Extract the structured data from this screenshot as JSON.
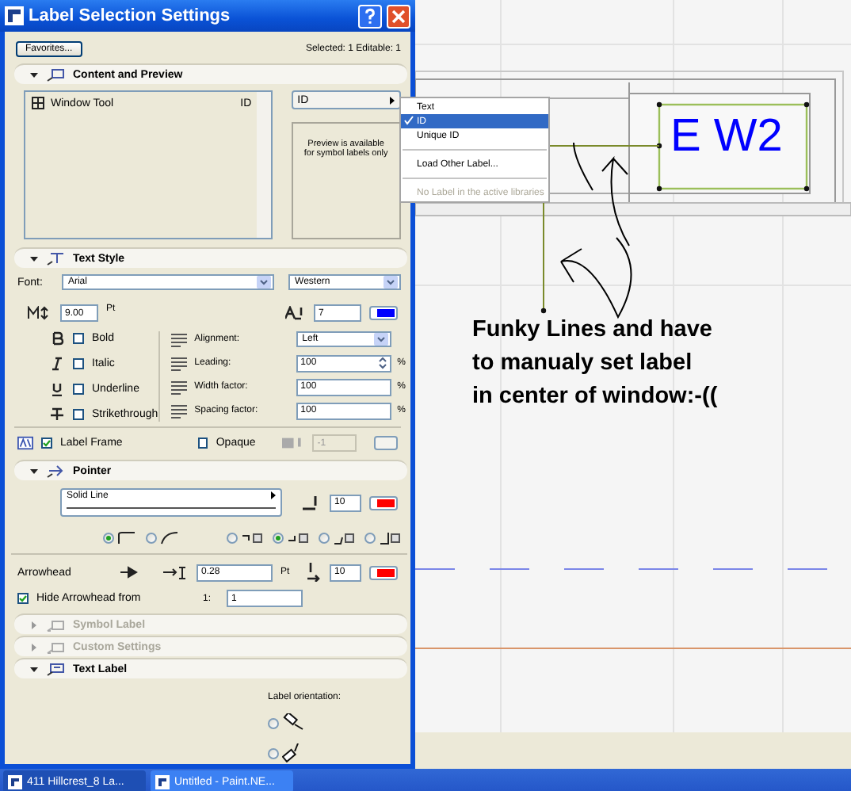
{
  "dialog": {
    "title": "Label Selection Settings",
    "favorites_button": "Favorites...",
    "selection_info": "Selected: 1 Editable: 1"
  },
  "sections": [
    {
      "kind": "content",
      "title": "Content and Preview",
      "expanded": true,
      "disabled": false,
      "tree_items": [
        {
          "label": "Window Tool",
          "value": "ID"
        }
      ],
      "label_type": "ID",
      "preview_note": "Preview is available for symbol labels only"
    },
    {
      "kind": "text_style",
      "title": "Text Style",
      "expanded": true,
      "disabled": false,
      "font_label": "Font:",
      "font": "Arial",
      "script": "Western",
      "size": "9.00",
      "size_unit": "Pt",
      "pen": "7",
      "styles": [
        {
          "label": "Bold",
          "checked": false
        },
        {
          "label": "Italic",
          "checked": false
        },
        {
          "label": "Underline",
          "checked": false
        },
        {
          "label": "Strikethrough",
          "checked": false
        }
      ],
      "settings": [
        {
          "kind": "dropdown",
          "label": "Alignment:",
          "value": "Left"
        },
        {
          "kind": "spinner",
          "label": "Leading:",
          "value": "100",
          "unit": "%"
        },
        {
          "kind": "field",
          "label": "Width factor:",
          "value": "100",
          "unit": "%"
        },
        {
          "kind": "field",
          "label": "Spacing factor:",
          "value": "100",
          "unit": "%"
        }
      ],
      "label_frame": {
        "label": "Label Frame",
        "checked": true
      },
      "opaque": {
        "label": "Opaque",
        "checked": false
      },
      "fill_pen": "-1"
    },
    {
      "kind": "pointer",
      "title": "Pointer",
      "expanded": true,
      "disabled": false,
      "line_type": "Solid Line",
      "pen": "10",
      "shape_options": [
        {
          "selected": true
        },
        {
          "selected": false
        }
      ],
      "attach_options": [
        {
          "selected": false
        },
        {
          "selected": true
        },
        {
          "selected": false
        },
        {
          "selected": false
        }
      ],
      "arrowhead_label": "Arrowhead",
      "arrow_size": "0.28",
      "arrow_unit": "Pt",
      "arrow_pen": "10",
      "hide_arrowhead": {
        "label": "Hide Arrowhead from",
        "checked": true
      },
      "scale_prefix": "1:",
      "scale": "1"
    },
    {
      "kind": "collapsed",
      "title": "Symbol Label",
      "expanded": false,
      "disabled": true
    },
    {
      "kind": "collapsed",
      "title": "Custom Settings",
      "expanded": false,
      "disabled": true
    },
    {
      "kind": "text_label",
      "title": "Text Label",
      "expanded": true,
      "disabled": false,
      "orientation_label": "Label orientation:",
      "orientation_options": [
        {
          "selected": false
        },
        {
          "selected": false
        }
      ]
    }
  ],
  "label_menu": [
    {
      "kind": "item",
      "label": "Text",
      "selected": false,
      "disabled": false
    },
    {
      "kind": "item",
      "label": "ID",
      "selected": true,
      "disabled": false
    },
    {
      "kind": "item",
      "label": "Unique ID",
      "selected": false,
      "disabled": false
    },
    {
      "kind": "separator"
    },
    {
      "kind": "item",
      "label": "Load Other Label...",
      "selected": false,
      "disabled": false
    },
    {
      "kind": "separator"
    },
    {
      "kind": "item",
      "label": "No Label in the active libraries",
      "selected": false,
      "disabled": true
    }
  ],
  "drawing": {
    "label_text": "E W2",
    "annotation": "Funky Lines and have\nto manualy set label\nin center of window:-(("
  },
  "taskbar": [
    {
      "label": "411 Hillcrest_8 La...",
      "selected": true
    },
    {
      "label": "Untitled - Paint.NE...",
      "selected": false
    }
  ]
}
